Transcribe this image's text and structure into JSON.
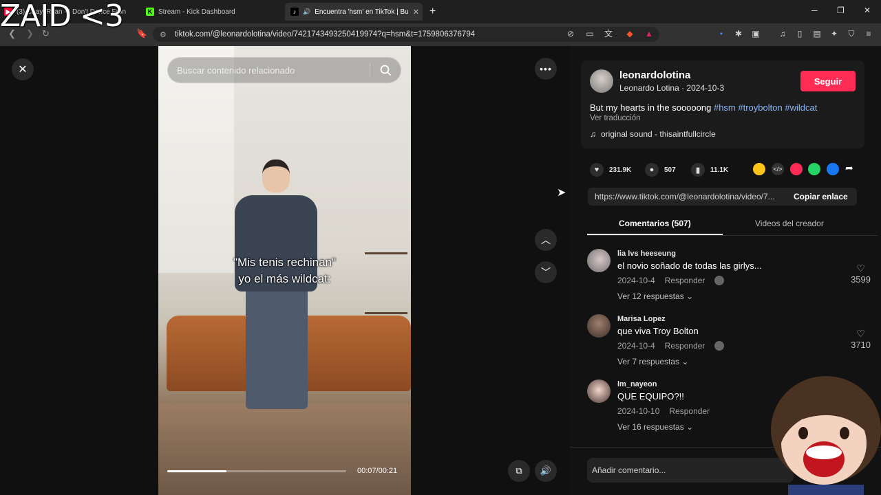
{
  "overlay": {
    "text": "ZAID <3"
  },
  "tabs": [
    {
      "title": "(3) Chay, Ryan - I Don't Dance Fron",
      "favicon": "youtube-icon"
    },
    {
      "title": "Stream - Kick Dashboard",
      "favicon": "kick-icon"
    },
    {
      "title": "Encuentra 'hsm' en TikTok | Bu",
      "favicon": "tiktok-icon",
      "active": true
    }
  ],
  "browser": {
    "url": "tiktok.com/@leonardolotina/video/7421743493250419974?q=hsm&t=1759806376794"
  },
  "video": {
    "search_placeholder": "Buscar contenido relacionado",
    "caption_line1": "\"Mis tenis rechinan\"",
    "caption_line2": "yo el más wildcat:",
    "time": "00:07/00:21",
    "progress": 0.33
  },
  "post": {
    "username": "leonardolotina",
    "display_name": "Leonardo Lotina",
    "date": "2024-10-3",
    "follow_label": "Seguir",
    "description": "But my hearts in the sooooong",
    "hashtags": [
      "#hsm",
      "#troybolton",
      "#wildcat"
    ],
    "translate_label": "Ver traducción",
    "sound": "original sound - thisaintfullcircle",
    "likes": "231.9K",
    "comments": "507",
    "saves": "11.1K",
    "link": "https://www.tiktok.com/@leonardolotina/video/7...",
    "copy_link_label": "Copiar enlace"
  },
  "panel_tabs": {
    "comments": "Comentarios (507)",
    "creator_videos": "Videos del creador"
  },
  "comments": [
    {
      "user": "lia lvs heeseung",
      "text": "el novio soñado de todas las girlys...",
      "date": "2024-10-4",
      "reply_label": "Responder",
      "likes": "3599",
      "replies": "Ver 12 respuestas"
    },
    {
      "user": "Marisa Lopez",
      "text": "que viva Troy Bolton",
      "date": "2024-10-4",
      "reply_label": "Responder",
      "likes": "3710",
      "replies": "Ver 7 respuestas"
    },
    {
      "user": "lm_nayeon",
      "text": "QUE EQUIPO?!!",
      "date": "2024-10-10",
      "reply_label": "Responder",
      "likes": "",
      "replies": "Ver 16 respuestas"
    }
  ],
  "add_comment_placeholder": "Añadir comentario..."
}
